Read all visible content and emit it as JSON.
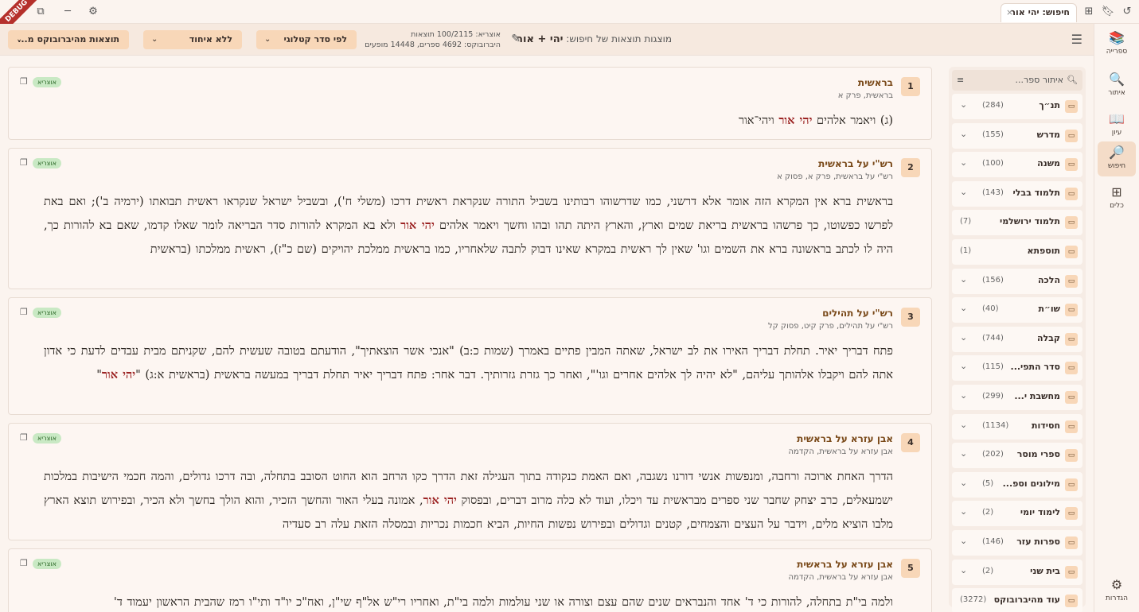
{
  "window": {
    "debug_label": "DEBUG",
    "tab_title": "חיפוש: יהי אור",
    "tab_close": "×"
  },
  "rail": [
    {
      "label": "ספרייה",
      "icon": "library-icon",
      "glyph": "📚"
    },
    {
      "label": "איתור",
      "icon": "find-book-icon",
      "glyph": "🔍"
    },
    {
      "label": "עיון",
      "icon": "reading-icon",
      "glyph": "📖"
    },
    {
      "label": "חיפוש",
      "icon": "search-icon",
      "glyph": "🔎"
    },
    {
      "label": "כלים",
      "icon": "tools-icon",
      "glyph": "⊞"
    }
  ],
  "settings_label": "הגדרות",
  "search": {
    "prefix": "מוצגות תוצאות של חיפוש:",
    "query": "יהי + אור",
    "stats_line1": "אוצריא: 100/2115 תוצאות",
    "stats_line2": "היברובוקס: 4692 ספרים, 14448 מופעים",
    "sort": "לפי סדר קטלוגי",
    "group": "ללא איחוד",
    "source": "תוצאות מהיברובוקס מ..."
  },
  "results": [
    {
      "num": "1",
      "title": "בראשית",
      "subtitle": "בראשית, פרק א",
      "badge": "אוצריא",
      "pre": "(ג) ויאמר אלהים ",
      "hl": "יהי אור",
      "post": " ויהי־אור"
    },
    {
      "num": "2",
      "title": "רש\"י על בראשית",
      "subtitle": "רש\"י על בראשית, פרק א, פסוק א",
      "badge": "אוצריא",
      "pre": "בראשית ברא אין המקרא הזה אומר אלא דרשני, כמו שדרשוהו רבותינו בשביל התורה שנקראת ראשית דרכו (משלי ח'), ובשביל ישראל שנקראו ראשית תבואתו (ירמיה ב'); ואם באת לפרשו כפשוטו, כך פרשהו בראשית בריאת שמים וארץ, והארץ היתה תהו ובהו וחשך ויאמר אלהים ",
      "hl": "יהי אור",
      "post": " ולא בא המקרא להורות סדר הבריאה לומר שאלו קדמו, שאם בא להורות כך, היה לו לכתב בראשונה ברא את השמים וגו' שאין לך ראשית במקרא שאינו דבוק לתבה שלאחריו, כמו בראשית ממלכת יהויקים (שם כ\"ז), ראשית ממלכתו (בראשית"
    },
    {
      "num": "3",
      "title": "רש\"י על תהילים",
      "subtitle": "רש\"י על תהילים, פרק קיט, פסוק קל",
      "badge": "אוצריא",
      "pre": "פתח דבריך יאיר. תחלת דבריך האירו את לב ישראל, שאתה המבין פתיים באמרך (שמות כ:ב) \"אנכי אשר הוצאתיך\", הודעתם בטובה שעשית להם, שקניתם מבית עבדים לדעת כי אדון אתה להם ויקבלו אלהותך עליהם, \"לא יהיה לך אלהים אחרים וגו'\", ואחר כך גזרת גזרותיך. דבר אחר: פתח דבריך יאיר תחלת דבריך במעשה בראשית (בראשית א:ג) \"",
      "hl": "יהי אור",
      "post": "\""
    },
    {
      "num": "4",
      "title": "אבן עזרא על בראשית",
      "subtitle": "אבן עזרא על בראשית, הקדמה",
      "badge": "אוצריא",
      "pre": "הדרך האחת ארוכה ורחבה, ומנפשות אנשי דורנו נשגבה, ואם האמת כנקודה בתוך העגילה זאת הדרך כקו הרחב הוא החוט הסובב בתחלה, ובה דרכו גדולים, והמה חכמי הישיבות במלכות ישמעאלים, כרב יצחק שחבר שני ספרים מבראשית עד ויכלו, ועוד לא כלה מרוב דברים, ובפסוק ",
      "hl": "יהי אור",
      "post": ", אמונה בעלי האור והחשך הזכיר, והוא הולך בחשך ולא הכיר, ובפירוש תוצא הארץ מלבו הוציא מלים, וידבר על העצים והצמחים, קטנים וגדולים ובפירוש נפשות החיות, הביא חכמות נכריות ובמסלה הזאת עלה רב סעדיה"
    },
    {
      "num": "5",
      "title": "אבן עזרא על בראשית",
      "subtitle": "אבן עזרא על בראשית, הקדמה",
      "badge": "אוצריא",
      "pre": "ולמה בי\"ת בתחלה, להורות כי ד' אחד והנבראים שנים שהם עצם וצורה או שני עולמות ולמה בי\"ת, ואחריו רי\"ש אל\"ף שי\"ן, ואח\"כ יו\"ד ותי\"ו רמז שהבית הראשון יעמוד ד'",
      "hl": "",
      "post": ""
    }
  ],
  "sidebar": {
    "filter_placeholder": "איתור ספר...",
    "categories": [
      {
        "name": "תנ״ך",
        "count": "(284)",
        "expand": true
      },
      {
        "name": "מדרש",
        "count": "(155)",
        "expand": true
      },
      {
        "name": "משנה",
        "count": "(100)",
        "expand": true
      },
      {
        "name": "תלמוד בבלי",
        "count": "(143)",
        "expand": true
      },
      {
        "name": "תלמוד ירושלמי",
        "count": "(7)",
        "expand": false
      },
      {
        "name": "תוספתא",
        "count": "(1)",
        "expand": false
      },
      {
        "name": "הלכה",
        "count": "(156)",
        "expand": true
      },
      {
        "name": "שו״ת",
        "count": "(40)",
        "expand": true
      },
      {
        "name": "קבלה",
        "count": "(744)",
        "expand": true
      },
      {
        "name": "סדר התפי...",
        "count": "(115)",
        "expand": true
      },
      {
        "name": "מחשבת י...",
        "count": "(299)",
        "expand": true
      },
      {
        "name": "חסידות",
        "count": "(1134)",
        "expand": true
      },
      {
        "name": "ספרי מוסר",
        "count": "(202)",
        "expand": true
      },
      {
        "name": "מילונים וספ...",
        "count": "(5)",
        "expand": true
      },
      {
        "name": "לימוד יומי",
        "count": "(2)",
        "expand": true
      },
      {
        "name": "ספרות עזר",
        "count": "(146)",
        "expand": true
      },
      {
        "name": "בית שני",
        "count": "(2)",
        "expand": true
      },
      {
        "name": "עוד מהיברובוקס",
        "count": "(3272)",
        "expand": false
      }
    ]
  }
}
